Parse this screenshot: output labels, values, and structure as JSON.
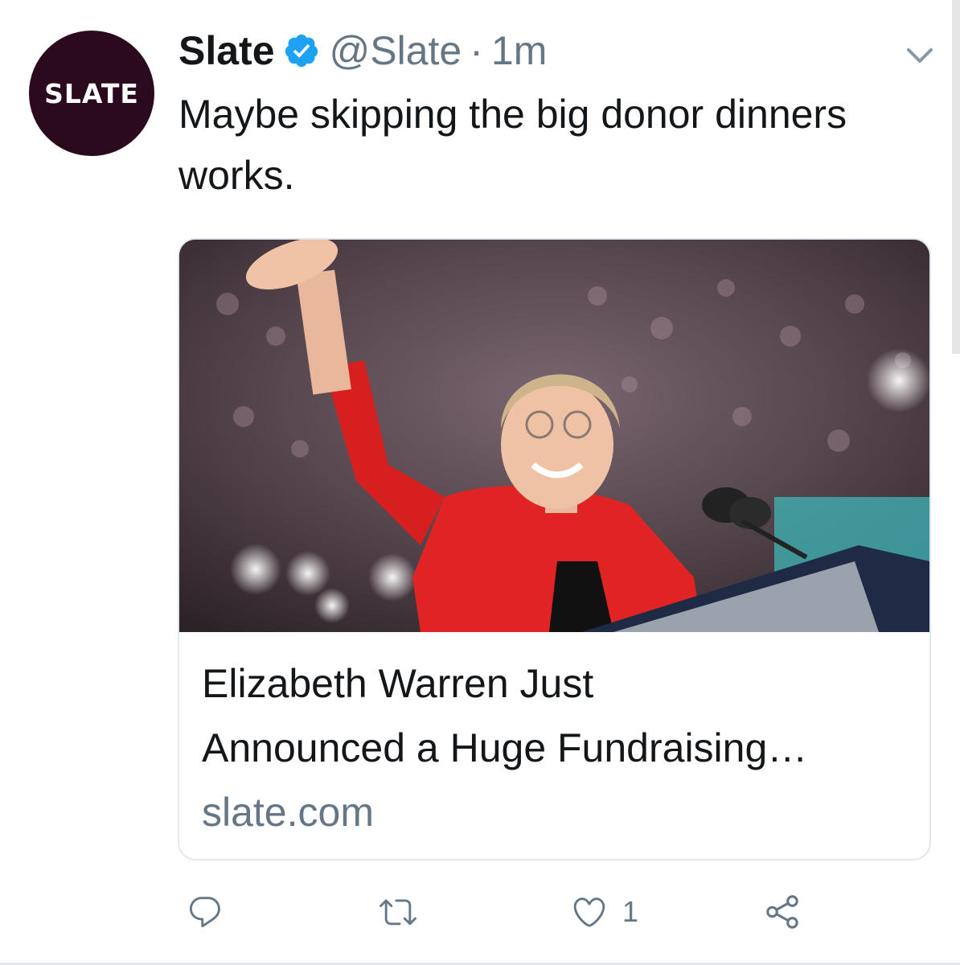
{
  "tweet": {
    "avatar_text": "SLATE",
    "display_name": "Slate",
    "handle": "@Slate",
    "separator": "·",
    "time": "1m",
    "text": "Maybe skipping the big donor dinners works.",
    "card": {
      "title_line1": "Elizabeth Warren Just",
      "title_line2": "Announced a Huge Fundraising…",
      "domain": "slate.com"
    },
    "actions": {
      "like_count": "1"
    }
  },
  "colors": {
    "verified_blue": "#1da1f2",
    "secondary_text": "#657786",
    "avatar_bg": "#2c0a1e",
    "border": "#e1e8ed"
  },
  "icons": [
    "verified-badge-icon",
    "chevron-down-icon",
    "reply-icon",
    "retweet-icon",
    "heart-icon",
    "share-icon"
  ]
}
